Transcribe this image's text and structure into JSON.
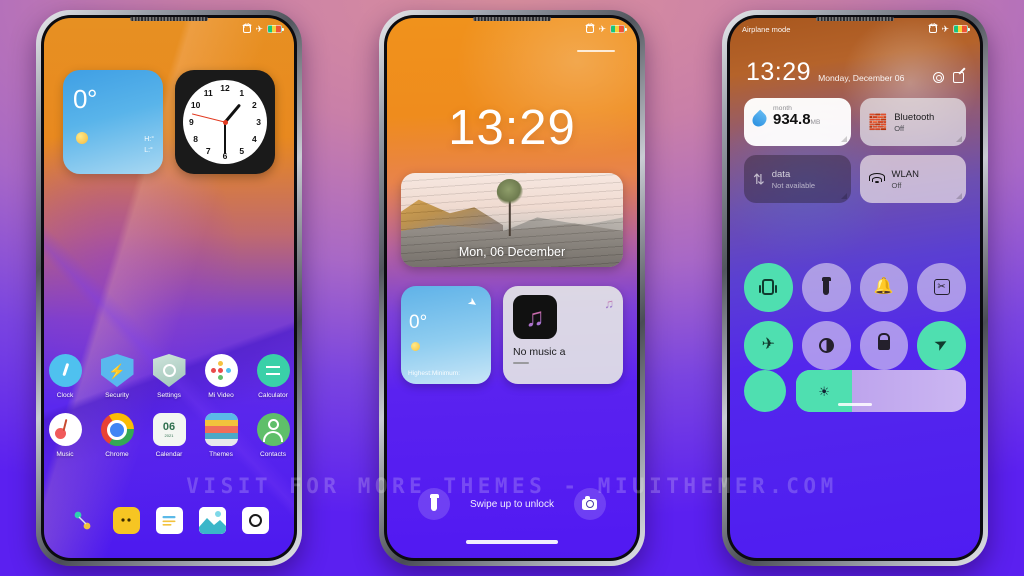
{
  "watermark": "VISIT FOR MORE THEMES - MIUITHEMER.COM",
  "theme": {
    "accent_teal": "#4fdfb0",
    "background_top": "#d98f9e",
    "background_bottom": "#5b20f0"
  },
  "phone1": {
    "name": "home-screen",
    "statusbar": {
      "alarm_icon": "alarm-icon",
      "airplane_icon": "airplane-icon",
      "battery_icon": "battery-icon"
    },
    "weather_widget": {
      "temperature": "0°",
      "high": "H:°",
      "low": "L:°",
      "condition_icon": "sun-icon"
    },
    "clock_widget": {
      "name": "analog-clock-widget",
      "numbers": [
        "12",
        "1",
        "2",
        "3",
        "4",
        "5",
        "6",
        "7",
        "8",
        "9",
        "10",
        "11"
      ]
    },
    "apps": [
      {
        "label": "Clock",
        "icon": "clock-icon"
      },
      {
        "label": "Security",
        "icon": "shield-icon"
      },
      {
        "label": "Settings",
        "icon": "gear-icon"
      },
      {
        "label": "Mi Video",
        "icon": "video-icon"
      },
      {
        "label": "Calculator",
        "icon": "calculator-icon"
      },
      {
        "label": "Music",
        "icon": "music-icon"
      },
      {
        "label": "Chrome",
        "icon": "chrome-icon"
      },
      {
        "label": "Calendar",
        "icon": "calendar-icon",
        "day": "06",
        "month": "2021"
      },
      {
        "label": "Themes",
        "icon": "themes-icon"
      },
      {
        "label": "Contacts",
        "icon": "contacts-icon"
      }
    ],
    "dock": [
      {
        "name": "share-icon"
      },
      {
        "name": "messages-icon"
      },
      {
        "name": "notes-icon"
      },
      {
        "name": "gallery-icon"
      },
      {
        "name": "camera-icon"
      }
    ]
  },
  "phone2": {
    "name": "lock-screen",
    "time": "13:29",
    "photo_widget": {
      "date": "Mon, 06 December"
    },
    "weather_widget": {
      "temperature": "0°",
      "detail": "Highest:Minimum:",
      "location_icon": "location-arrow-icon",
      "condition_icon": "sun-icon"
    },
    "music_widget": {
      "title": "No music a",
      "album_icon": "music-note-icon",
      "badge_icon": "music-note-badge-icon"
    },
    "unlock_hint": "Swipe up to unlock",
    "flashlight_icon": "flashlight-icon",
    "camera_icon": "camera-icon"
  },
  "phone3": {
    "name": "control-center",
    "statusbar_label": "Airplane mode",
    "time": "13:29",
    "date": "Monday, December 06",
    "settings_icon": "gear-icon",
    "edit_icon": "edit-icon",
    "cards": [
      {
        "name": "data-usage-card",
        "header": "month",
        "value": "934.8",
        "unit": "MB",
        "icon": "water-drop-icon",
        "style": "light"
      },
      {
        "name": "bluetooth-card",
        "title": "Bluetooth",
        "status": "Off",
        "icon": "bluetooth-icon",
        "style": "frost"
      },
      {
        "name": "mobile-data-card",
        "title": "data",
        "status": "Not available",
        "icon": "data-transfer-icon",
        "style": "dark"
      },
      {
        "name": "wlan-card",
        "title": "WLAN",
        "status": "Off",
        "icon": "wifi-icon",
        "style": "frost2"
      }
    ],
    "toggles": [
      {
        "name": "vibrate-toggle",
        "icon": "vibrate-icon",
        "state": "on"
      },
      {
        "name": "flashlight-toggle",
        "icon": "flashlight-icon",
        "state": "off"
      },
      {
        "name": "dnd-toggle",
        "icon": "bell-icon",
        "state": "off"
      },
      {
        "name": "screenshot-toggle",
        "icon": "scissors-icon",
        "state": "off"
      },
      {
        "name": "airplane-toggle",
        "icon": "airplane-icon",
        "state": "on"
      },
      {
        "name": "dark-mode-toggle",
        "icon": "contrast-icon",
        "state": "off"
      },
      {
        "name": "lock-toggle",
        "icon": "lock-icon",
        "state": "off"
      },
      {
        "name": "location-toggle",
        "icon": "location-arrow-icon",
        "state": "on"
      }
    ],
    "brightness": {
      "name": "brightness-slider",
      "icon": "brightness-icon",
      "percent": 33
    }
  }
}
